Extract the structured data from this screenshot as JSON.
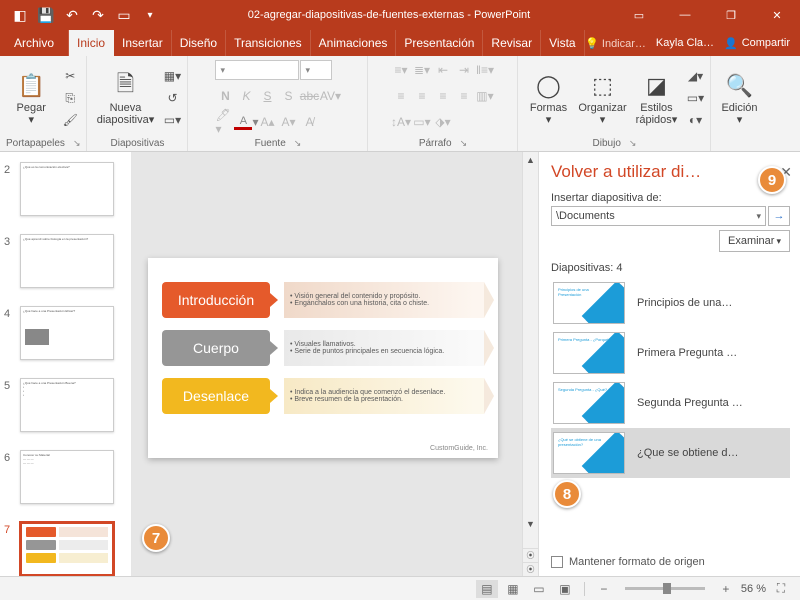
{
  "titlebar": {
    "doc_title": "02-agregar-diapositivas-de-fuentes-externas - PowerPoint"
  },
  "menubar": {
    "file": "Archivo",
    "tabs": [
      "Inicio",
      "Insertar",
      "Diseño",
      "Transiciones",
      "Animaciones",
      "Presentación",
      "Revisar",
      "Vista"
    ],
    "tellme": "Indicar…",
    "user": "Kayla Cla…",
    "share": "Compartir"
  },
  "ribbon": {
    "clipboard": {
      "paste": "Pegar",
      "label": "Portapapeles"
    },
    "slides": {
      "newslide": "Nueva diapositiva",
      "label": "Diapositivas"
    },
    "font": {
      "label": "Fuente"
    },
    "paragraph": {
      "label": "Párrafo"
    },
    "drawing": {
      "shapes": "Formas",
      "arrange": "Organizar",
      "quick": "Estilos rápidos",
      "label": "Dibujo"
    },
    "editing": {
      "label": "Edición"
    }
  },
  "thumbnails": {
    "items": [
      {
        "num": "2"
      },
      {
        "num": "3"
      },
      {
        "num": "4"
      },
      {
        "num": "5"
      },
      {
        "num": "6"
      },
      {
        "num": "7"
      }
    ]
  },
  "slide": {
    "row1": {
      "tag": "Introducción",
      "b1": "Visión general del contenido y propósito.",
      "b2": "Engánchalos con una historia, cita o chiste."
    },
    "row2": {
      "tag": "Cuerpo",
      "b1": "Visuales llamativos.",
      "b2": "Serie de puntos principales en secuencia lógica."
    },
    "row3": {
      "tag": "Desenlace",
      "b1": "Indica a la audiencia que comenzó el desenlace.",
      "b2": "Breve resumen de la presentación."
    },
    "footer": "CustomGuide, Inc."
  },
  "pane": {
    "title": "Volver a utilizar di…",
    "insert_from": "Insertar diapositiva de:",
    "path": "\\Documents",
    "browse": "Examinar",
    "count": "Diapositivas: 4",
    "items": [
      "Principios de una…",
      "Primera Pregunta …",
      "Segunda Pregunta …",
      "¿Que se obtiene d…"
    ],
    "keep": "Mantener formato de origen"
  },
  "status": {
    "zoom": "56 %"
  },
  "callouts": {
    "b7": "7",
    "b8": "8",
    "b9": "9"
  }
}
